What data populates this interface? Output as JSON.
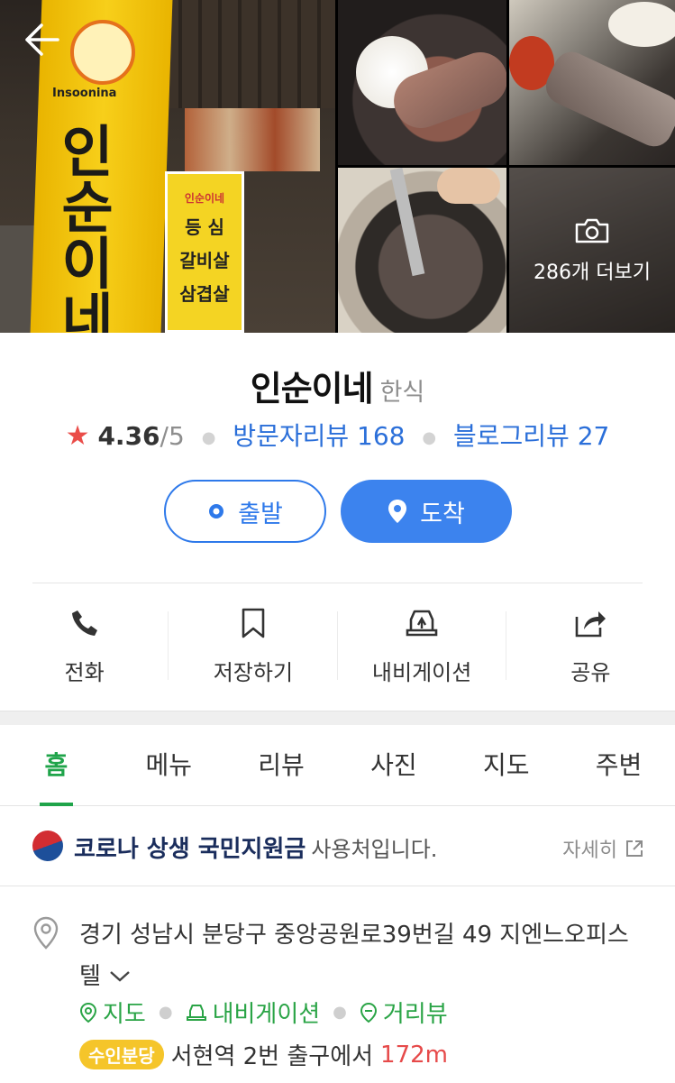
{
  "gallery": {
    "main_banner_chars": [
      "인",
      "순",
      "이",
      "네"
    ],
    "main_banner_en": "Insoonina",
    "side_sign": [
      "인순이네",
      "등  심",
      "갈비살",
      "삼겹살"
    ],
    "more_label": "286개 더보기"
  },
  "place": {
    "name": "인순이네",
    "category": "한식",
    "rating": "4.36",
    "rating_max": "/5",
    "visitor_reviews": "방문자리뷰 168",
    "blog_reviews": "블로그리뷰 27"
  },
  "buttons": {
    "start": "출발",
    "arrive": "도착"
  },
  "actions": [
    {
      "label": "전화",
      "icon": "phone-icon"
    },
    {
      "label": "저장하기",
      "icon": "bookmark-icon"
    },
    {
      "label": "내비게이션",
      "icon": "car-navigation-icon"
    },
    {
      "label": "공유",
      "icon": "share-icon"
    }
  ],
  "tabs": [
    "홈",
    "메뉴",
    "리뷰",
    "사진",
    "지도",
    "주변"
  ],
  "active_tab": "홈",
  "notice": {
    "title": "코로나 상생 국민지원금",
    "suffix": "사용처입니다.",
    "more": "자세히"
  },
  "location": {
    "address": "경기 성남시 분당구 중앙공원로39번길 49 지엔느오피스텔",
    "links": [
      "지도",
      "내비게이션",
      "거리뷰"
    ],
    "line_badge": "수인분당",
    "station_text": "서현역 2번 출구에서",
    "distance": "172m"
  },
  "colors": {
    "accent_green": "#1fa44a",
    "accent_blue": "#2e79ea",
    "star_red": "#ea4d49",
    "line_yellow": "#f5c52a"
  }
}
